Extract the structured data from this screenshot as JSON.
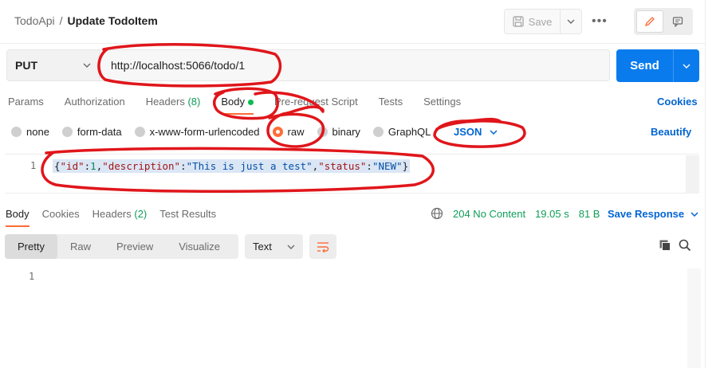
{
  "header": {
    "collection": "TodoApi",
    "separator": "/",
    "request_name": "Update TodoItem",
    "save_label": "Save",
    "more_label": "•••"
  },
  "request": {
    "method": "PUT",
    "url": "http://localhost:5066/todo/1",
    "send_label": "Send"
  },
  "request_tabs": [
    {
      "label": "Params"
    },
    {
      "label": "Authorization"
    },
    {
      "label": "Headers",
      "count": "(8)"
    },
    {
      "label": "Body",
      "active": true
    },
    {
      "label": "Pre-request Script"
    },
    {
      "label": "Tests"
    },
    {
      "label": "Settings"
    }
  ],
  "cookies_label": "Cookies",
  "body_types": [
    "none",
    "form-data",
    "x-www-form-urlencoded",
    "raw",
    "binary",
    "GraphQL"
  ],
  "body_type_selected": "raw",
  "body_format": "JSON",
  "beautify_label": "Beautify",
  "editor": {
    "line_number": "1",
    "code_parts": [
      "{",
      "\"id\"",
      ":",
      "1",
      ",",
      "\"description\"",
      ":",
      "\"This is just a test\"",
      ",",
      "\"status\"",
      ":",
      "\"NEW\"",
      "}"
    ]
  },
  "response_tabs": [
    {
      "label": "Body",
      "active": true
    },
    {
      "label": "Cookies"
    },
    {
      "label": "Headers",
      "count": "(2)"
    },
    {
      "label": "Test Results"
    }
  ],
  "response_status": {
    "status": "204 No Content",
    "time": "19.05 s",
    "size": "81 B"
  },
  "save_response_label": "Save Response",
  "format_tabs": [
    "Pretty",
    "Raw",
    "Preview",
    "Visualize"
  ],
  "format_selected": "Pretty",
  "text_select": "Text",
  "response_line_number": "1",
  "colors": {
    "accent": "#ff6c37",
    "send": "#097bed",
    "link": "#0265d2",
    "status_ok": "#0f9d58",
    "annotation": "#e0161b"
  }
}
